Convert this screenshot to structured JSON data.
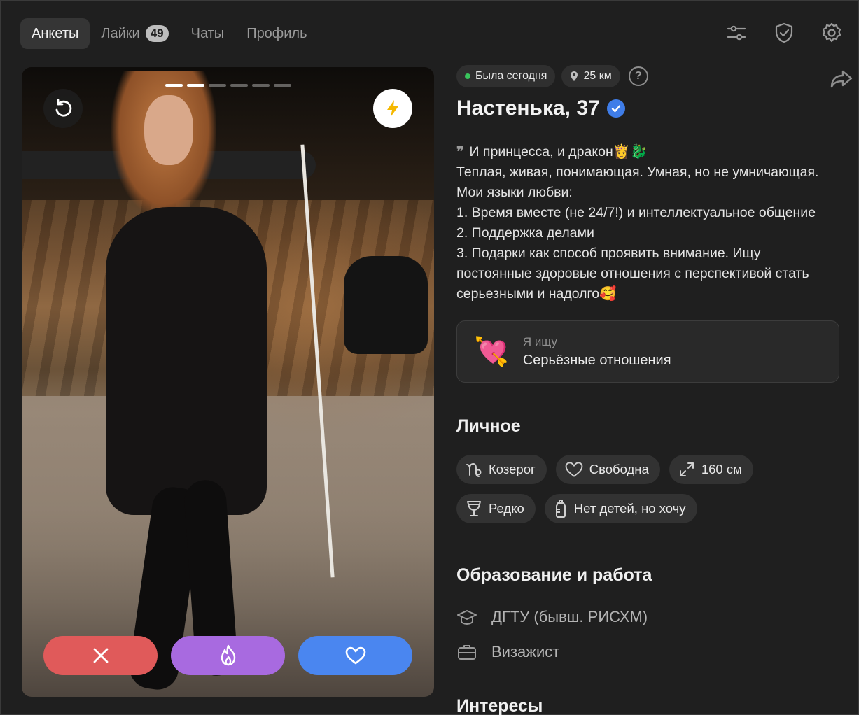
{
  "nav": {
    "tabs": [
      {
        "label": "Анкеты"
      },
      {
        "label": "Лайки",
        "badge": "49"
      },
      {
        "label": "Чаты"
      },
      {
        "label": "Профиль"
      }
    ],
    "icons": [
      "filters-icon",
      "shield-check-icon",
      "settings-gear-icon"
    ]
  },
  "photo": {
    "total_photos": 6,
    "current_photo": 2
  },
  "profile": {
    "status": "Была сегодня",
    "distance": "25 км",
    "help": "?",
    "name": "Настенька, 37",
    "bio": "И принцесса, и дракон👸🐉\nТеплая, живая, понимающая. Умная, но не умничающая.\nМои языки любви:\n1. Время вместе (не 24/7!) и интеллектуальное общение\n2. Поддержка делами\n3. Подарки как способ проявить внимание. Ищу постоянные здоровые отношения с перспективой стать серьезными и надолго🥰",
    "looking_for": {
      "label": "Я ищу",
      "value": "Серьёзные отношения",
      "emoji": "💘"
    }
  },
  "personal": {
    "title": "Личное",
    "tags": [
      {
        "icon": "capricorn-icon",
        "label": "Козерог"
      },
      {
        "icon": "heart-outline-icon",
        "label": "Свободна"
      },
      {
        "icon": "height-arrows-icon",
        "label": "160 см"
      },
      {
        "icon": "wine-glass-icon",
        "label": "Редко"
      },
      {
        "icon": "baby-bottle-icon",
        "label": "Нет детей, но хочу"
      }
    ]
  },
  "education": {
    "title": "Образование и работа",
    "items": [
      {
        "icon": "graduation-cap-icon",
        "label": "ДГТУ (бывш. РИСХМ)"
      },
      {
        "icon": "briefcase-icon",
        "label": "Визажист"
      }
    ]
  },
  "interests": {
    "title": "Интересы"
  },
  "colors": {
    "accent_blue": "#4a86f0",
    "nope_red": "#e05a5a",
    "super_purple": "#a86ae0",
    "online_green": "#39c45c"
  }
}
